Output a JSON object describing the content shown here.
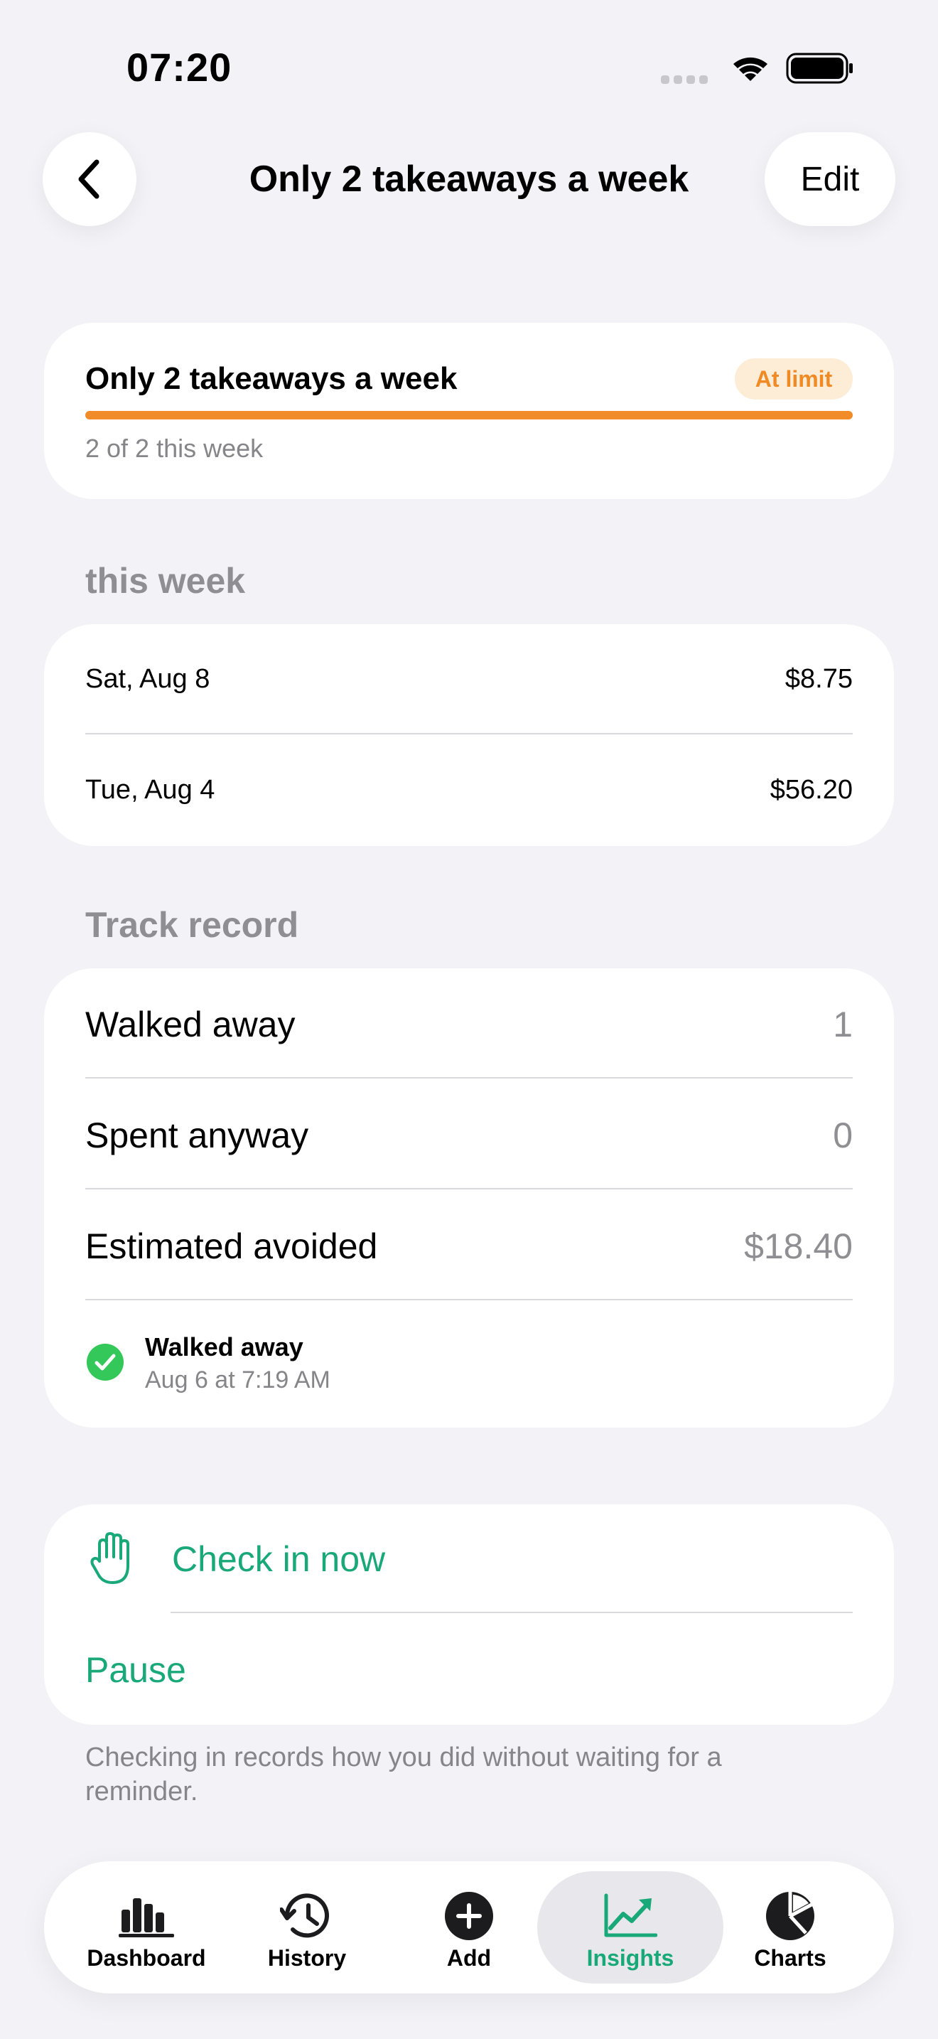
{
  "status_bar": {
    "time": "07:20"
  },
  "nav": {
    "title": "Only 2 takeaways a week",
    "edit_label": "Edit"
  },
  "goal": {
    "title": "Only 2 takeaways a week",
    "badge": "At limit",
    "progress_text": "2 of 2 this week",
    "progress_fraction": 1.0,
    "accent_color": "#f28c28"
  },
  "this_week": {
    "header": "this week",
    "rows": [
      {
        "date": "Sat, Aug 8",
        "amount": "$8.75"
      },
      {
        "date": "Tue, Aug 4",
        "amount": "$56.20"
      }
    ]
  },
  "track_record": {
    "header": "Track record",
    "stats": [
      {
        "label": "Walked away",
        "value": "1"
      },
      {
        "label": "Spent anyway",
        "value": "0"
      },
      {
        "label": "Estimated avoided",
        "value": "$18.40"
      }
    ],
    "entry": {
      "title": "Walked away",
      "subtitle": "Aug 6 at 7:19 AM",
      "icon": "check-circle-icon"
    }
  },
  "actions": {
    "check_in_label": "Check in now",
    "pause_label": "Pause",
    "color": "#19a877"
  },
  "footnote": "Checking in records how you did without waiting for a reminder.",
  "tab_bar": {
    "active": "Insights",
    "tabs": [
      {
        "label": "Dashboard",
        "icon": "bar-chart-icon"
      },
      {
        "label": "History",
        "icon": "history-clock-icon"
      },
      {
        "label": "Add",
        "icon": "plus-circle-icon"
      },
      {
        "label": "Insights",
        "icon": "trend-up-icon"
      },
      {
        "label": "Charts",
        "icon": "pie-chart-icon"
      }
    ]
  }
}
